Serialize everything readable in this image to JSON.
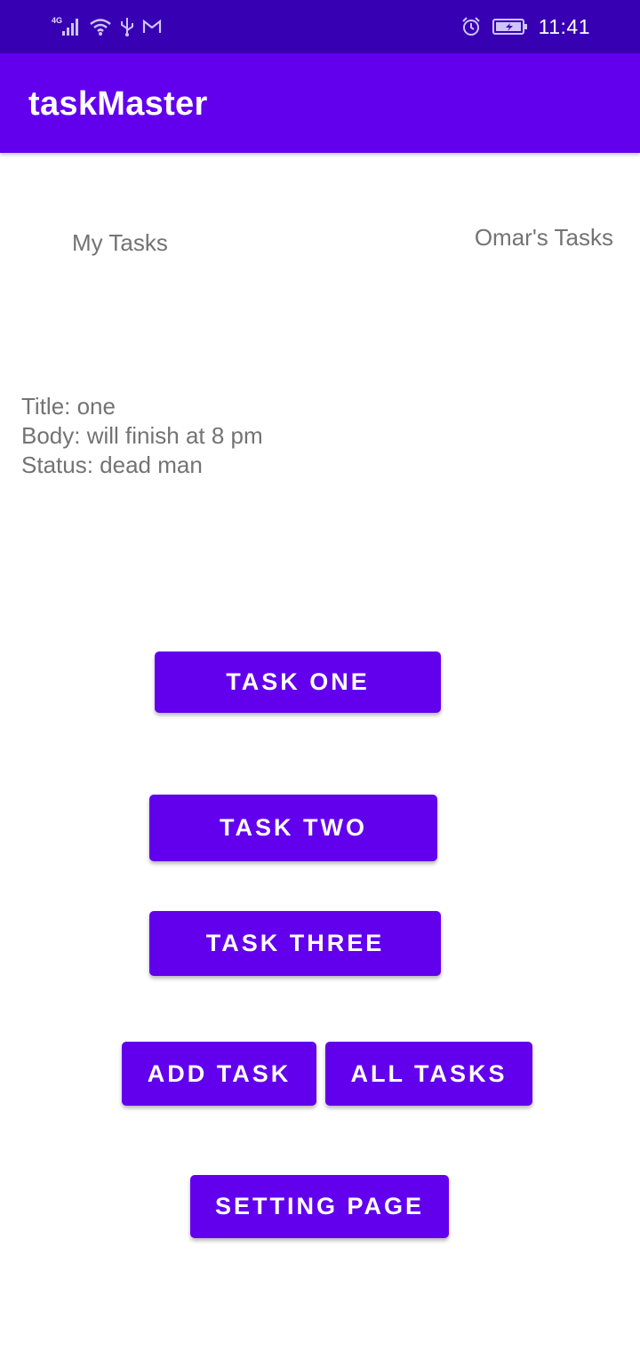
{
  "status_bar": {
    "network_label": "4G",
    "time": "11:41",
    "icons": [
      "signal-icon",
      "wifi-icon",
      "usb-icon",
      "gmail-icon",
      "alarm-icon",
      "battery-icon"
    ]
  },
  "app_bar": {
    "title": "taskMaster"
  },
  "main": {
    "my_tasks_label": "My Tasks",
    "user_tasks_label": "Omar's Tasks",
    "task_detail": {
      "title_line": "Title: one",
      "body_line": "Body: will finish at 8 pm",
      "status_line": "Status: dead man"
    }
  },
  "buttons": {
    "task_one": "TASK ONE",
    "task_two": "TASK TWO",
    "task_three": "TASK THREE",
    "add_task": "ADD TASK",
    "all_tasks": "ALL TASKS",
    "setting_page": "SETTING PAGE"
  },
  "colors": {
    "status_bar": "#3700b3",
    "primary": "#6200ee",
    "text_gray": "#737373",
    "background": "#ffffff"
  }
}
